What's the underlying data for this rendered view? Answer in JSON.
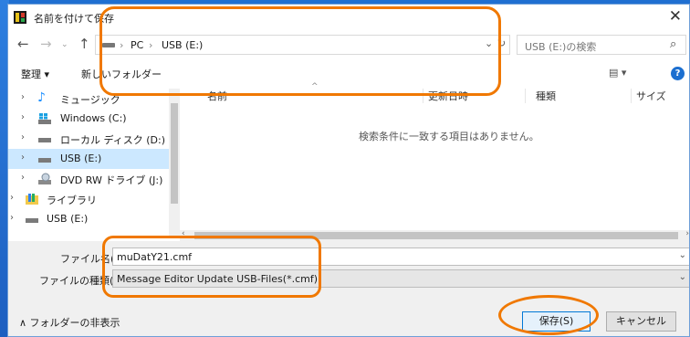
{
  "window": {
    "title": "名前を付けて保存",
    "close_glyph": "✕"
  },
  "nav": {
    "back": "←",
    "forward": "→",
    "up": "↑"
  },
  "address": {
    "crumbs": [
      "PC",
      "USB (E:)"
    ],
    "separator": "›",
    "dropdown": "⌄",
    "refresh": "↻"
  },
  "search": {
    "placeholder": "USB (E:)の検索",
    "icon": "⌕"
  },
  "toolbar": {
    "organize": "整理 ▾",
    "new_folder": "新しいフォルダー",
    "view": "▤ ▾",
    "help": "?"
  },
  "tree": {
    "items": [
      {
        "label": "ミュージック",
        "icon": "music-icon"
      },
      {
        "label": "Windows (C:)",
        "icon": "windows-drive-icon"
      },
      {
        "label": "ローカル ディスク (D:)",
        "icon": "drive-icon"
      },
      {
        "label": "USB (E:)",
        "icon": "drive-icon",
        "selected": true
      },
      {
        "label": "DVD RW ドライブ (J:)",
        "icon": "dvd-icon"
      },
      {
        "label": "ライブラリ",
        "icon": "library-icon"
      },
      {
        "label": "USB (E:)",
        "icon": "drive-icon"
      }
    ]
  },
  "columns": [
    "名前",
    "更新日時",
    "種類",
    "サイズ"
  ],
  "empty_message": "検索条件に一致する項目はありません。",
  "filename": {
    "label": "ファイル名(N):",
    "value": "muDatY21.cmf"
  },
  "filetype": {
    "label": "ファイルの種類(T):",
    "value": "Message Editor Update USB-Files(*.cmf)"
  },
  "hide_folders": "∧ フォルダーの非表示",
  "buttons": {
    "save": "保存(S)",
    "cancel": "キャンセル"
  },
  "colors": {
    "accent": "#0078d7",
    "selection": "#cce8ff",
    "annotation": "#f07800"
  }
}
